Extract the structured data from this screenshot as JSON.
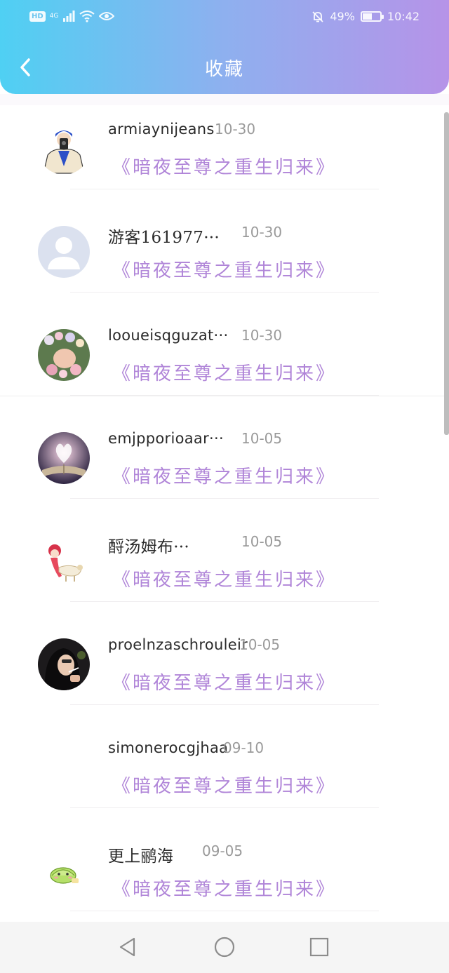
{
  "status_bar": {
    "hd_badge": "HD",
    "network_type": "4G",
    "battery_percent": "49%",
    "battery_level": 0.49,
    "time": "10:42",
    "icons": [
      "signal-icon",
      "wifi-icon",
      "eye-icon",
      "mute-bell-icon",
      "battery-icon"
    ]
  },
  "header": {
    "title": "收藏",
    "back_icon": "chevron-left-icon"
  },
  "favorites": [
    {
      "user": "armiaynijeans",
      "date": "10-30",
      "book": "《暗夜至尊之重生归来》",
      "avatar": "cartoon-photographer"
    },
    {
      "user": "游客161977···",
      "date": "10-30",
      "book": "《暗夜至尊之重生归来》",
      "avatar": "default-placeholder"
    },
    {
      "user": "looueisqguzat···",
      "date": "10-30",
      "book": "《暗夜至尊之重生归来》",
      "avatar": "flower-crown-girl"
    },
    {
      "user": "emjpporioaar···",
      "date": "10-05",
      "book": "《暗夜至尊之重生归来》",
      "avatar": "heart-book"
    },
    {
      "user": "酹汤姆布···",
      "date": "10-05",
      "book": "《暗夜至尊之重生归来》",
      "avatar": "anime-character"
    },
    {
      "user": "proelnzaschrouleir",
      "date": "10-05",
      "book": "《暗夜至尊之重生归来》",
      "avatar": "dark-hair-girl"
    },
    {
      "user": "simonerocgjhaa",
      "date": "09-10",
      "book": "《暗夜至尊之重生归来》",
      "avatar": "none"
    },
    {
      "user": "更上鹂海",
      "date": "09-05",
      "book": "《暗夜至尊之重生归来》",
      "avatar": "green-dumpling"
    }
  ],
  "nav_bar": {
    "icons": [
      "back-triangle-icon",
      "home-circle-icon",
      "recents-square-icon"
    ]
  }
}
